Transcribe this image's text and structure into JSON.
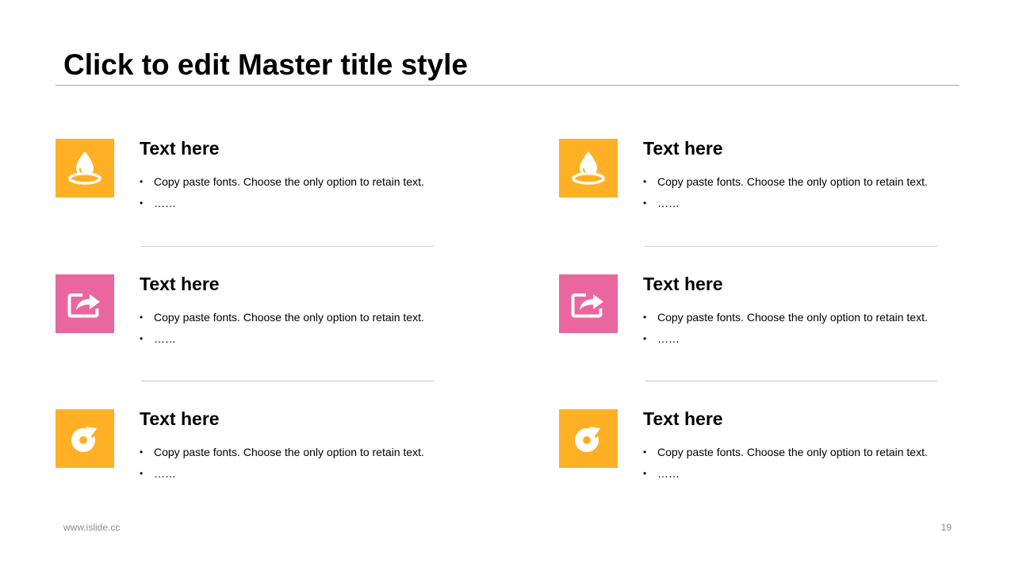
{
  "slide": {
    "title": "Click to edit Master title style",
    "footer_url": "www.islide.cc",
    "page_number": "19"
  },
  "colors": {
    "orange": "#FFB025",
    "pink": "#E9679E"
  },
  "items": [
    {
      "heading": "Text here",
      "icon": "water-drop-icon",
      "color": "#FFB025",
      "bullets": [
        "Copy paste fonts. Choose the only option to retain text.",
        "……"
      ]
    },
    {
      "heading": "Text here",
      "icon": "water-drop-icon",
      "color": "#FFB025",
      "bullets": [
        "Copy paste fonts. Choose the only option to retain text.",
        "……"
      ]
    },
    {
      "heading": "Text here",
      "icon": "share-icon",
      "color": "#E9679E",
      "bullets": [
        "Copy paste fonts. Choose the only option to retain text.",
        "……"
      ]
    },
    {
      "heading": "Text here",
      "icon": "share-icon",
      "color": "#E9679E",
      "bullets": [
        "Copy paste fonts. Choose the only option to retain text.",
        "……"
      ]
    },
    {
      "heading": "Text here",
      "icon": "refresh-icon",
      "color": "#FFB025",
      "bullets": [
        "Copy paste fonts. Choose the only option to retain text.",
        "……"
      ]
    },
    {
      "heading": "Text here",
      "icon": "refresh-icon",
      "color": "#FFB025",
      "bullets": [
        "Copy paste fonts. Choose the only option to retain text.",
        "……"
      ]
    }
  ]
}
